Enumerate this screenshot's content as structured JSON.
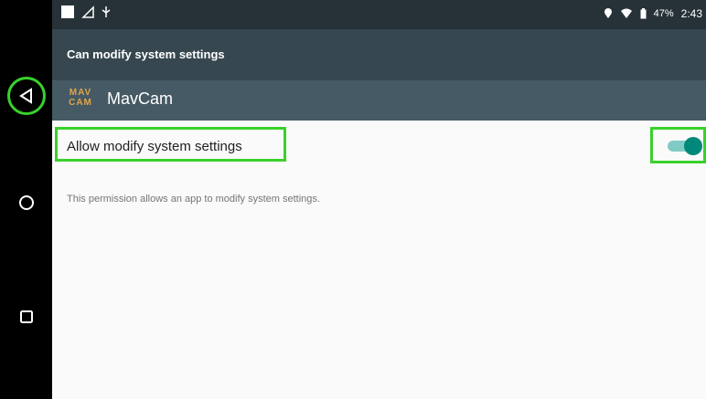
{
  "status_bar": {
    "battery": "47%",
    "time": "2:43"
  },
  "header": {
    "title": "Can modify system settings"
  },
  "app": {
    "logo_text_top": "MAV",
    "logo_text_bottom": "CAM",
    "name": "MavCam"
  },
  "setting": {
    "label": "Allow modify system settings",
    "enabled": true
  },
  "description": "This permission allows an app to modify system settings.",
  "colors": {
    "highlight": "#39d12b",
    "toggle_on": "#00897b",
    "toggle_track": "#80cbc4",
    "logo": "#e0a44b"
  },
  "icons": {
    "nav_back": "back-triangle-icon",
    "nav_home": "home-circle-icon",
    "nav_recent": "recent-square-icon",
    "status": [
      "notification-square-icon",
      "signal-icon",
      "usb-icon",
      "location-icon",
      "wifi-icon",
      "battery-icon"
    ]
  }
}
